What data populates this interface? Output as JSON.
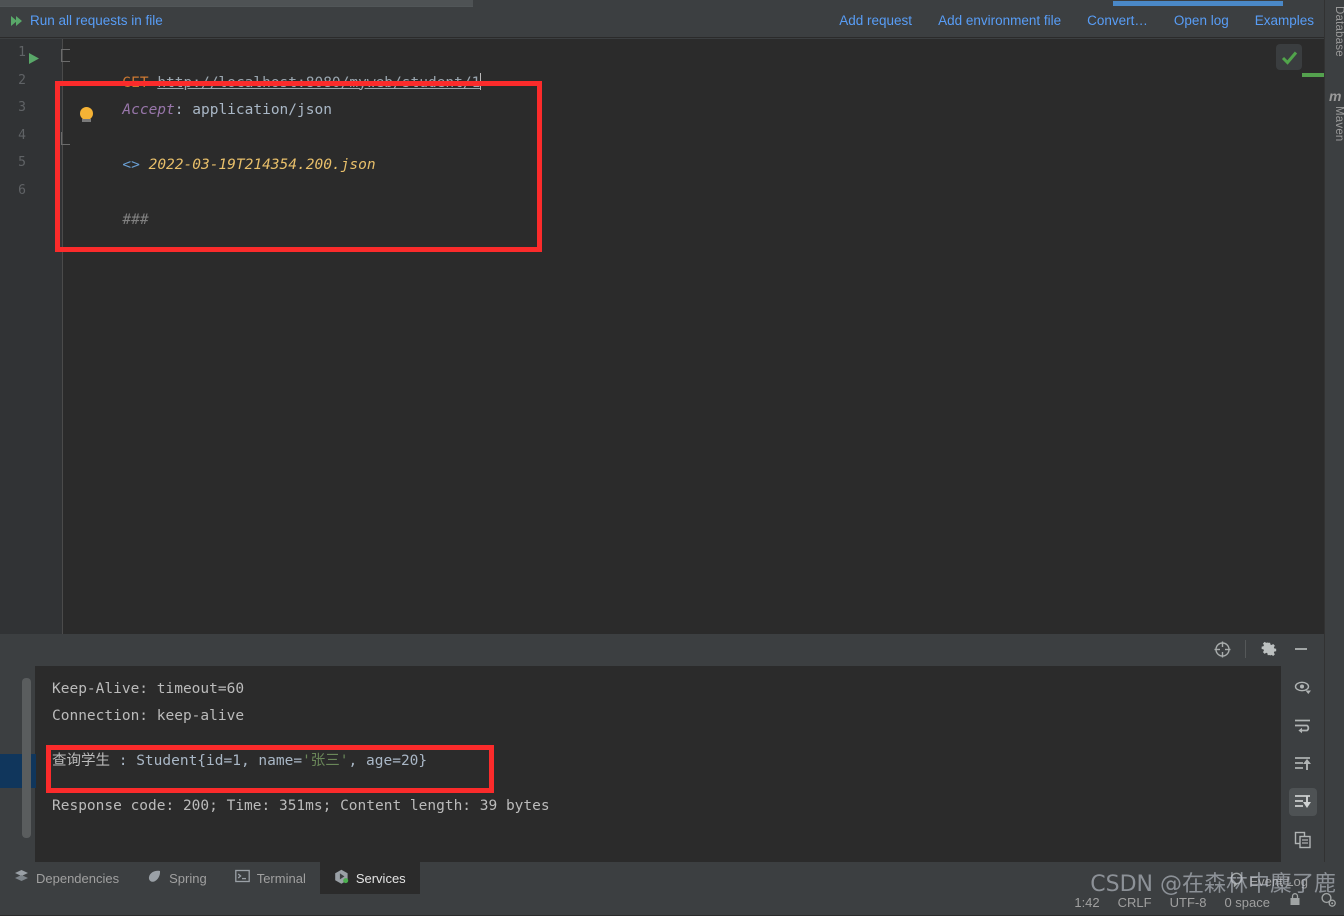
{
  "window": {
    "theme_bg": "#3c3f41",
    "editor_bg": "#2b2b2b",
    "accent_blue": "#589df6",
    "annotation_red": "#fb2b2b"
  },
  "http_toolbar": {
    "run_all_label": "Run all requests in file",
    "run_all_icon": "double-play-icon",
    "links": [
      {
        "label": "Add request",
        "name": "add-request-link"
      },
      {
        "label": "Add environment file",
        "name": "add-environment-file-link"
      },
      {
        "label": "Convert…",
        "name": "convert-link"
      },
      {
        "label": "Open log",
        "name": "open-log-link"
      },
      {
        "label": "Examples",
        "name": "examples-link"
      }
    ]
  },
  "editor": {
    "line_numbers": [
      "1",
      "2",
      "3",
      "4",
      "5",
      "6"
    ],
    "lines": [
      {
        "n": "1",
        "method": "GET",
        "url": "http://localhost:8080/myweb/student/1",
        "has_caret": true,
        "has_run_arrow": true
      },
      {
        "n": "2",
        "header_name": "Accept",
        "header_sep": ": ",
        "header_value": "application/json"
      },
      {
        "n": "3",
        "blank": true
      },
      {
        "n": "4",
        "response_op": "<>",
        "filename": "2022-03-19T214354.200.json"
      },
      {
        "n": "5",
        "blank": true
      },
      {
        "n": "6",
        "comment": "###"
      }
    ],
    "inspection_icon": "green-check-icon",
    "bulb_icon": "intention-bulb-icon"
  },
  "right_tool_strip": {
    "buttons": [
      {
        "label": "Database",
        "name": "tool-button-database",
        "icon": ""
      },
      {
        "label": "Maven",
        "name": "tool-button-maven",
        "icon": "m"
      }
    ]
  },
  "console": {
    "header_icons": [
      {
        "name": "locate-target-icon",
        "title": "target"
      },
      {
        "name": "gear-icon",
        "title": "settings"
      },
      {
        "name": "minimize-icon",
        "title": "hide"
      }
    ],
    "side_icons": [
      {
        "name": "eye-filter-icon",
        "active": false
      },
      {
        "name": "soft-wrap-icon",
        "active": false
      },
      {
        "name": "scroll-up-icon",
        "active": false
      },
      {
        "name": "scroll-down-icon",
        "active": true
      },
      {
        "name": "copy-icon",
        "active": false
      }
    ],
    "output": [
      {
        "type": "plain",
        "text": "Keep-Alive: timeout=60"
      },
      {
        "type": "plain",
        "text": "Connection: keep-alive"
      },
      {
        "type": "student",
        "prefix": "查询学生",
        "sep": " : ",
        "obj_open": "Student{id=",
        "id": "1",
        "mid": ", name=",
        "name_quoted": "'张三'",
        "age_key": ", age=",
        "age": "20",
        "obj_close": "}",
        "full": "查询学生 : Student{id=1, name='张三', age=20}",
        "highlighted": true
      },
      {
        "type": "plain",
        "text": "Response code: 200; Time: 351ms; Content length: 39 bytes"
      }
    ]
  },
  "statusbar": {
    "tabs": [
      {
        "label": "Dependencies",
        "name": "bottom-tab-dependencies",
        "icon": "layers-icon",
        "active": false
      },
      {
        "label": "Spring",
        "name": "bottom-tab-spring",
        "icon": "spring-leaf-icon",
        "active": false
      },
      {
        "label": "Terminal",
        "name": "bottom-tab-terminal",
        "icon": "terminal-icon",
        "active": false
      },
      {
        "label": "Services",
        "name": "bottom-tab-services",
        "icon": "services-play-icon",
        "active": true
      }
    ],
    "event_log": "Event Log",
    "caret_position": "1:42",
    "line_separator": "CRLF",
    "encoding": "UTF-8",
    "indent": "0 space",
    "watermark": "CSDN @在森林中麋了鹿"
  }
}
